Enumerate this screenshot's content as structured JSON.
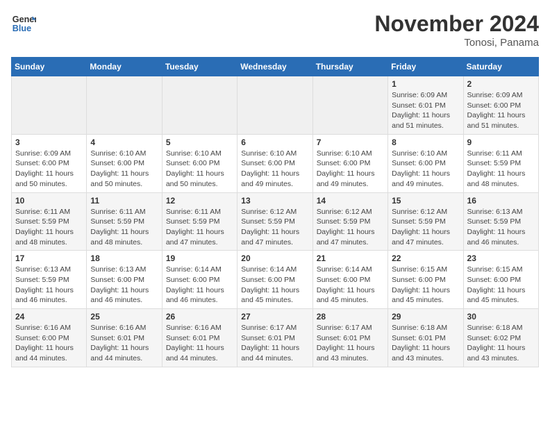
{
  "logo": {
    "line1": "General",
    "line2": "Blue"
  },
  "title": "November 2024",
  "location": "Tonosi, Panama",
  "days_of_week": [
    "Sunday",
    "Monday",
    "Tuesday",
    "Wednesday",
    "Thursday",
    "Friday",
    "Saturday"
  ],
  "weeks": [
    [
      {
        "day": "",
        "info": ""
      },
      {
        "day": "",
        "info": ""
      },
      {
        "day": "",
        "info": ""
      },
      {
        "day": "",
        "info": ""
      },
      {
        "day": "",
        "info": ""
      },
      {
        "day": "1",
        "info": "Sunrise: 6:09 AM\nSunset: 6:01 PM\nDaylight: 11 hours and 51 minutes."
      },
      {
        "day": "2",
        "info": "Sunrise: 6:09 AM\nSunset: 6:00 PM\nDaylight: 11 hours and 51 minutes."
      }
    ],
    [
      {
        "day": "3",
        "info": "Sunrise: 6:09 AM\nSunset: 6:00 PM\nDaylight: 11 hours and 50 minutes."
      },
      {
        "day": "4",
        "info": "Sunrise: 6:10 AM\nSunset: 6:00 PM\nDaylight: 11 hours and 50 minutes."
      },
      {
        "day": "5",
        "info": "Sunrise: 6:10 AM\nSunset: 6:00 PM\nDaylight: 11 hours and 50 minutes."
      },
      {
        "day": "6",
        "info": "Sunrise: 6:10 AM\nSunset: 6:00 PM\nDaylight: 11 hours and 49 minutes."
      },
      {
        "day": "7",
        "info": "Sunrise: 6:10 AM\nSunset: 6:00 PM\nDaylight: 11 hours and 49 minutes."
      },
      {
        "day": "8",
        "info": "Sunrise: 6:10 AM\nSunset: 6:00 PM\nDaylight: 11 hours and 49 minutes."
      },
      {
        "day": "9",
        "info": "Sunrise: 6:11 AM\nSunset: 5:59 PM\nDaylight: 11 hours and 48 minutes."
      }
    ],
    [
      {
        "day": "10",
        "info": "Sunrise: 6:11 AM\nSunset: 5:59 PM\nDaylight: 11 hours and 48 minutes."
      },
      {
        "day": "11",
        "info": "Sunrise: 6:11 AM\nSunset: 5:59 PM\nDaylight: 11 hours and 48 minutes."
      },
      {
        "day": "12",
        "info": "Sunrise: 6:11 AM\nSunset: 5:59 PM\nDaylight: 11 hours and 47 minutes."
      },
      {
        "day": "13",
        "info": "Sunrise: 6:12 AM\nSunset: 5:59 PM\nDaylight: 11 hours and 47 minutes."
      },
      {
        "day": "14",
        "info": "Sunrise: 6:12 AM\nSunset: 5:59 PM\nDaylight: 11 hours and 47 minutes."
      },
      {
        "day": "15",
        "info": "Sunrise: 6:12 AM\nSunset: 5:59 PM\nDaylight: 11 hours and 47 minutes."
      },
      {
        "day": "16",
        "info": "Sunrise: 6:13 AM\nSunset: 5:59 PM\nDaylight: 11 hours and 46 minutes."
      }
    ],
    [
      {
        "day": "17",
        "info": "Sunrise: 6:13 AM\nSunset: 5:59 PM\nDaylight: 11 hours and 46 minutes."
      },
      {
        "day": "18",
        "info": "Sunrise: 6:13 AM\nSunset: 6:00 PM\nDaylight: 11 hours and 46 minutes."
      },
      {
        "day": "19",
        "info": "Sunrise: 6:14 AM\nSunset: 6:00 PM\nDaylight: 11 hours and 46 minutes."
      },
      {
        "day": "20",
        "info": "Sunrise: 6:14 AM\nSunset: 6:00 PM\nDaylight: 11 hours and 45 minutes."
      },
      {
        "day": "21",
        "info": "Sunrise: 6:14 AM\nSunset: 6:00 PM\nDaylight: 11 hours and 45 minutes."
      },
      {
        "day": "22",
        "info": "Sunrise: 6:15 AM\nSunset: 6:00 PM\nDaylight: 11 hours and 45 minutes."
      },
      {
        "day": "23",
        "info": "Sunrise: 6:15 AM\nSunset: 6:00 PM\nDaylight: 11 hours and 45 minutes."
      }
    ],
    [
      {
        "day": "24",
        "info": "Sunrise: 6:16 AM\nSunset: 6:00 PM\nDaylight: 11 hours and 44 minutes."
      },
      {
        "day": "25",
        "info": "Sunrise: 6:16 AM\nSunset: 6:01 PM\nDaylight: 11 hours and 44 minutes."
      },
      {
        "day": "26",
        "info": "Sunrise: 6:16 AM\nSunset: 6:01 PM\nDaylight: 11 hours and 44 minutes."
      },
      {
        "day": "27",
        "info": "Sunrise: 6:17 AM\nSunset: 6:01 PM\nDaylight: 11 hours and 44 minutes."
      },
      {
        "day": "28",
        "info": "Sunrise: 6:17 AM\nSunset: 6:01 PM\nDaylight: 11 hours and 43 minutes."
      },
      {
        "day": "29",
        "info": "Sunrise: 6:18 AM\nSunset: 6:01 PM\nDaylight: 11 hours and 43 minutes."
      },
      {
        "day": "30",
        "info": "Sunrise: 6:18 AM\nSunset: 6:02 PM\nDaylight: 11 hours and 43 minutes."
      }
    ]
  ]
}
